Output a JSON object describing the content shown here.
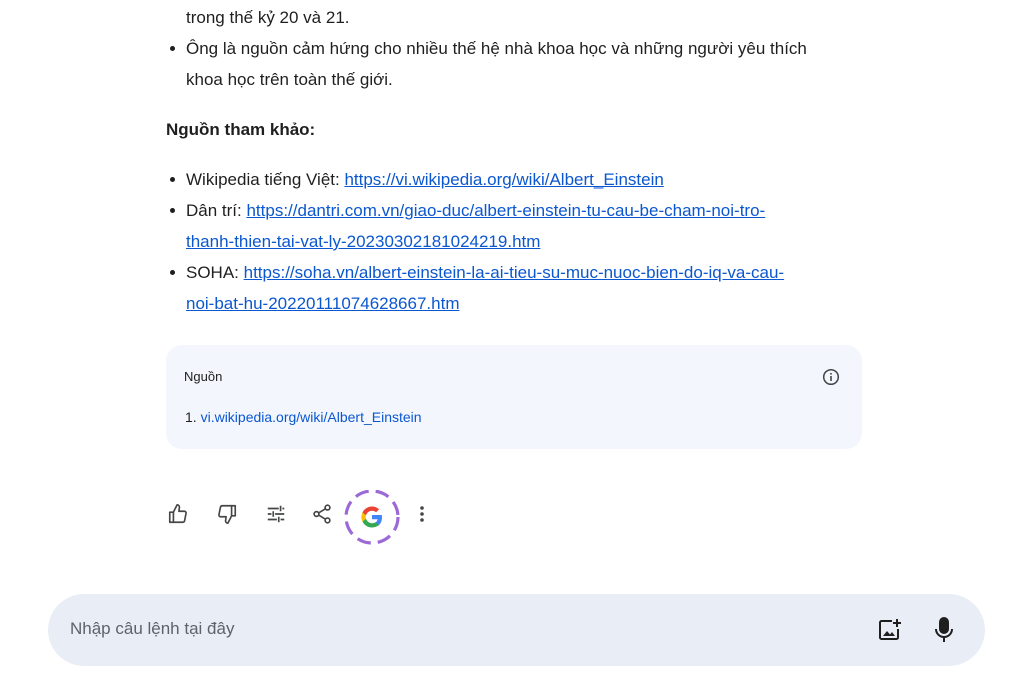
{
  "response": {
    "bullets_top": [
      {
        "text": "trong thế kỷ 20 và 21.",
        "continuation": true
      },
      {
        "text": "Ông là nguồn cảm hứng cho nhiều thế hệ nhà khoa học và những người yêu thích",
        "continuation": false
      },
      {
        "text": "khoa học trên toàn thế giới.",
        "continuation": true
      }
    ],
    "refs_heading": "Nguồn tham khảo:",
    "refs": [
      {
        "label": "Wikipedia tiếng Việt: ",
        "url_line1": "https://vi.wikipedia.org/wiki/Albert_Einstein",
        "url_line2": ""
      },
      {
        "label": "Dân trí: ",
        "url_line1": "https://dantri.com.vn/giao-duc/albert-einstein-tu-cau-be-cham-noi-tro-",
        "url_line2": "thanh-thien-tai-vat-ly-20230302181024219.htm"
      },
      {
        "label": "SOHA: ",
        "url_line1": "https://soha.vn/albert-einstein-la-ai-tieu-su-muc-nuoc-bien-do-iq-va-cau-",
        "url_line2": "noi-bat-hu-20220111074628667.htm"
      }
    ]
  },
  "sources": {
    "title": "Nguồn",
    "items": [
      {
        "number": "1.",
        "link": "vi.wikipedia.org/wiki/Albert_Einstein"
      }
    ]
  },
  "actions": {
    "icons": [
      "thumbs-up-icon",
      "thumbs-down-icon",
      "tune-icon",
      "share-icon",
      "google-g-icon",
      "more-vert-icon"
    ]
  },
  "input": {
    "placeholder": "Nhập câu lệnh tại đây"
  },
  "colors": {
    "link": "#0b57d0",
    "sources_bg": "#f3f6fc",
    "input_bg": "#e9eef6",
    "highlight_ring": "#9c6ad6"
  }
}
